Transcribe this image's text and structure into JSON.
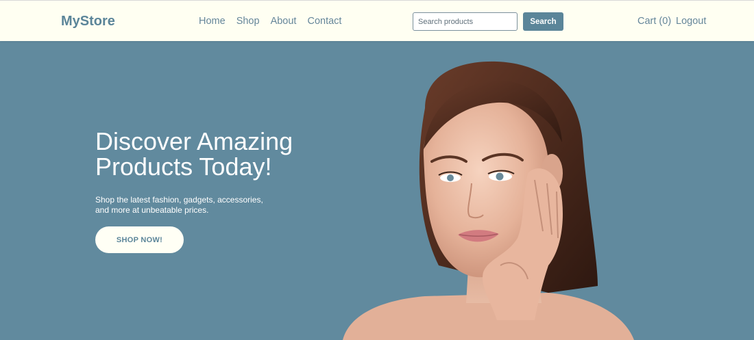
{
  "header": {
    "brand": "MyStore",
    "nav": [
      "Home",
      "Shop",
      "About",
      "Contact"
    ],
    "search": {
      "placeholder": "Search products",
      "value": "",
      "button_label": "Search"
    },
    "cart_label": "Cart (0)",
    "logout_label": "Logout"
  },
  "hero": {
    "title": "Discover Amazing Products Today!",
    "subtitle": "Shop the latest fashion, gadgets, accessories, and more at unbeatable prices.",
    "cta_label": "SHOP NOW!",
    "image_icon": "woman-portrait-photo"
  },
  "colors": {
    "accent": "#5b8599",
    "hero_bg": "#618a9e",
    "header_bg": "#fffff2",
    "skin": "#e9b9a0",
    "hair": "#4a2a1e"
  }
}
